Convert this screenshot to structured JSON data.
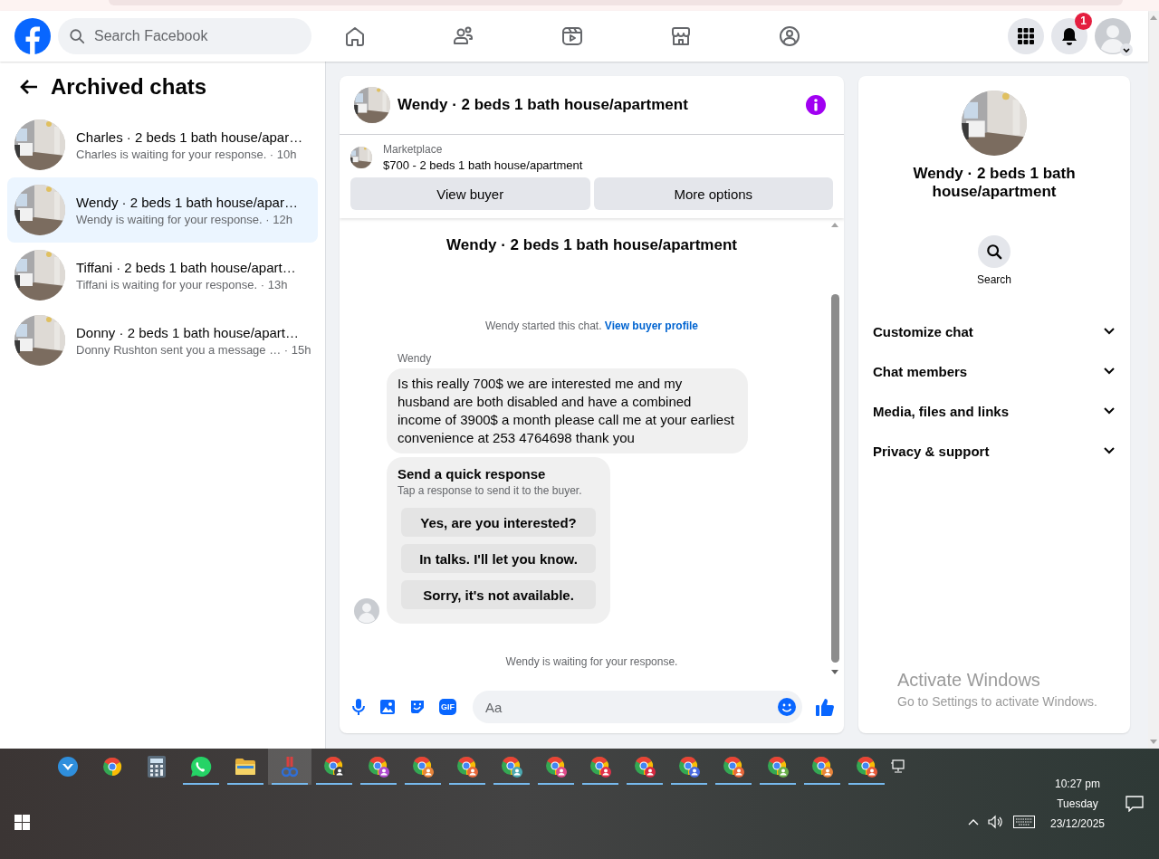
{
  "header": {
    "search": {
      "placeholder": "Search Facebook"
    },
    "nav": [
      {
        "kind": "home"
      },
      {
        "kind": "friends"
      },
      {
        "kind": "video"
      },
      {
        "kind": "marketplace"
      },
      {
        "kind": "groups"
      }
    ],
    "notifications": {
      "badge": "1"
    }
  },
  "sidebar": {
    "title": "Archived chats",
    "chats": [
      {
        "name": "Charles · 2 beds 1 bath house/apar…",
        "preview": "Charles is waiting for your response. · 10h",
        "selected": false
      },
      {
        "name": "Wendy · 2 beds 1 bath house/apar…",
        "preview": "Wendy is waiting for your response. · 12h",
        "selected": true
      },
      {
        "name": "Tiffani · 2 beds 1 bath house/apart…",
        "preview": "Tiffani is waiting for your response. · 13h",
        "selected": false
      },
      {
        "name": "Donny · 2 beds 1 bath house/apart…",
        "preview": "Donny Rushton sent you a message … · 15h",
        "selected": false
      }
    ]
  },
  "chat": {
    "title": "Wendy · 2 beds 1 bath house/apartment",
    "listing": {
      "label": "Marketplace",
      "title": "$700 - 2 beds 1 bath house/apartment"
    },
    "buttons": [
      "View buyer",
      "More options"
    ],
    "intro_title": "Wendy · 2 beds 1 bath house/apartment",
    "started": {
      "text": "Wendy started this chat.",
      "link": "View buyer profile"
    },
    "messages": [
      {
        "kind": "text",
        "sender": "Wendy",
        "text": "Is this really 700$ we are interested me and my husband are both disabled and have a combined income of 3900$ a month please call me at your earliest convenience at 253 4764698 thank you"
      },
      {
        "kind": "quick_responses",
        "title": "Send a quick response",
        "subtitle": "Tap a response to send it to the buyer.",
        "options": [
          "Yes, are you interested?",
          "In talks. I'll let you know.",
          "Sorry, it's not available."
        ]
      }
    ],
    "status": "Wendy is waiting for your response.",
    "composer": {
      "gif_label": "GIF",
      "placeholder": "Aa"
    }
  },
  "details": {
    "title": "Wendy · 2 beds 1 bath house/apartment",
    "search_label": "Search",
    "sections": [
      {
        "label": "Customize chat",
        "expanded": false
      },
      {
        "label": "Chat members",
        "expanded": false
      },
      {
        "label": "Media, files and links",
        "expanded": false
      },
      {
        "label": "Privacy & support",
        "expanded": false
      }
    ]
  },
  "watermark": {
    "title": "Activate Windows",
    "subtitle": "Go to Settings to activate Windows."
  },
  "taskbar": {
    "apps": [
      {
        "kind": "download",
        "running": false,
        "selected": false
      },
      {
        "kind": "browser",
        "running": false,
        "selected": false
      },
      {
        "kind": "calculator",
        "running": false,
        "selected": false
      },
      {
        "kind": "whatsapp",
        "running": true,
        "selected": false
      },
      {
        "kind": "folder",
        "running": true,
        "selected": false
      },
      {
        "kind": "scissors",
        "running": true,
        "selected": true
      },
      {
        "kind": "profile",
        "color": "#3a3a3a",
        "running": true,
        "selected": false
      },
      {
        "kind": "profile",
        "color": "#b04ad0",
        "running": true,
        "selected": false
      },
      {
        "kind": "profile",
        "color": "#e8843a",
        "running": true,
        "selected": false
      },
      {
        "kind": "profile",
        "color": "#e8673a",
        "running": true,
        "selected": false
      },
      {
        "kind": "profile",
        "color": "#4aa8b0",
        "running": true,
        "selected": false
      },
      {
        "kind": "profile",
        "color": "#e04a8a",
        "running": true,
        "selected": false
      },
      {
        "kind": "profile",
        "color": "#e0304a",
        "running": true,
        "selected": false
      },
      {
        "kind": "profile",
        "color": "#d82840",
        "running": true,
        "selected": false
      },
      {
        "kind": "profile",
        "color": "#4a6ae0",
        "running": true,
        "selected": false
      },
      {
        "kind": "profile",
        "color": "#e8673a",
        "running": true,
        "selected": false
      },
      {
        "kind": "profile",
        "color": "#6ab04a",
        "running": true,
        "selected": false
      },
      {
        "kind": "profile",
        "color": "#e8843a",
        "running": true,
        "selected": false
      },
      {
        "kind": "profile",
        "color": "#e85a3a",
        "running": true,
        "selected": false
      }
    ],
    "clock": {
      "time": "10:27 pm",
      "day": "Tuesday",
      "date": "23/12/2025"
    }
  }
}
